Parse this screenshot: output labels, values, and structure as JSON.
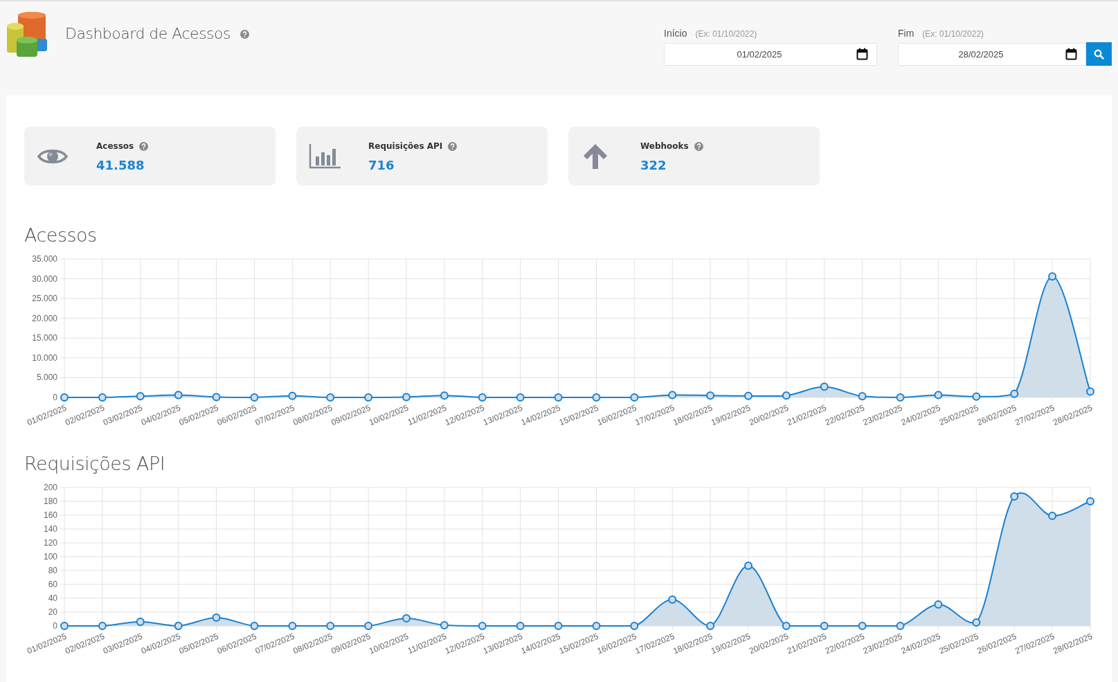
{
  "header": {
    "title": "Dashboard de Acessos",
    "filters": [
      {
        "label": "Início",
        "hint": "(Ex: 01/10/2022)",
        "value": "01/02/2025"
      },
      {
        "label": "Fim",
        "hint": "(Ex: 01/10/2022)",
        "value": "28/02/2025"
      }
    ]
  },
  "cards": [
    {
      "kind": "views",
      "label": "Acessos",
      "value": "41.588"
    },
    {
      "kind": "requests",
      "label": "Requisições API",
      "value": "716"
    },
    {
      "kind": "webhooks",
      "label": "Webhooks",
      "value": "322"
    }
  ],
  "charts": [
    {
      "title": "Acessos",
      "chart_data": {
        "type": "area",
        "categories": [
          "01/02/2025",
          "02/02/2025",
          "03/02/2025",
          "04/02/2025",
          "05/02/2025",
          "06/02/2025",
          "07/02/2025",
          "08/02/2025",
          "09/02/2025",
          "10/02/2025",
          "11/02/2025",
          "12/02/2025",
          "13/02/2025",
          "14/02/2025",
          "15/02/2025",
          "16/02/2025",
          "17/02/2025",
          "18/02/2025",
          "19/02/2025",
          "20/02/2025",
          "21/02/2025",
          "22/02/2025",
          "23/02/2025",
          "24/02/2025",
          "25/02/2025",
          "26/02/2025",
          "27/02/2025",
          "28/02/2025"
        ],
        "grid": true,
        "series": [
          {
            "color": "#1a80d0",
            "values": [
              0,
              0,
              300,
              600,
              100,
              0,
              400,
              0,
              0,
              100,
              500,
              0,
              0,
              0,
              0,
              0,
              600,
              500,
              400,
              500,
              2700,
              300,
              0,
              600,
              200,
              900,
              30600,
              1500
            ]
          }
        ],
        "ylim": [
          0,
          35000
        ],
        "yticks": [
          {
            "value": 0,
            "label": "0"
          },
          {
            "value": 5000,
            "label": "5.000"
          },
          {
            "value": 10000,
            "label": "10.000"
          },
          {
            "value": 15000,
            "label": "15.000"
          },
          {
            "value": 20000,
            "label": "20.000"
          },
          {
            "value": 25000,
            "label": "25.000"
          },
          {
            "value": 30000,
            "label": "30.000"
          },
          {
            "value": 35000,
            "label": "35.000"
          }
        ]
      }
    },
    {
      "title": "Requisições API",
      "chart_data": {
        "type": "area",
        "categories": [
          "01/02/2025",
          "02/02/2025",
          "03/02/2025",
          "04/02/2025",
          "05/02/2025",
          "06/02/2025",
          "07/02/2025",
          "08/02/2025",
          "09/02/2025",
          "10/02/2025",
          "11/02/2025",
          "12/02/2025",
          "13/02/2025",
          "14/02/2025",
          "15/02/2025",
          "16/02/2025",
          "17/02/2025",
          "18/02/2025",
          "19/02/2025",
          "20/02/2025",
          "21/02/2025",
          "22/02/2025",
          "23/02/2025",
          "24/02/2025",
          "25/02/2025",
          "26/02/2025",
          "27/02/2025",
          "28/02/2025"
        ],
        "grid": true,
        "series": [
          {
            "color": "#1a80d0",
            "values": [
              0,
              0,
              6,
              0,
              12,
              0,
              0,
              0,
              0,
              11,
              1,
              0,
              0,
              0,
              0,
              0,
              38,
              0,
              87,
              0,
              0,
              0,
              0,
              31,
              5,
              187,
              159,
              180
            ]
          }
        ],
        "ylim": [
          0,
          200
        ],
        "yticks": [
          0,
          20,
          40,
          60,
          80,
          100,
          120,
          140,
          160,
          180,
          200
        ]
      }
    }
  ]
}
